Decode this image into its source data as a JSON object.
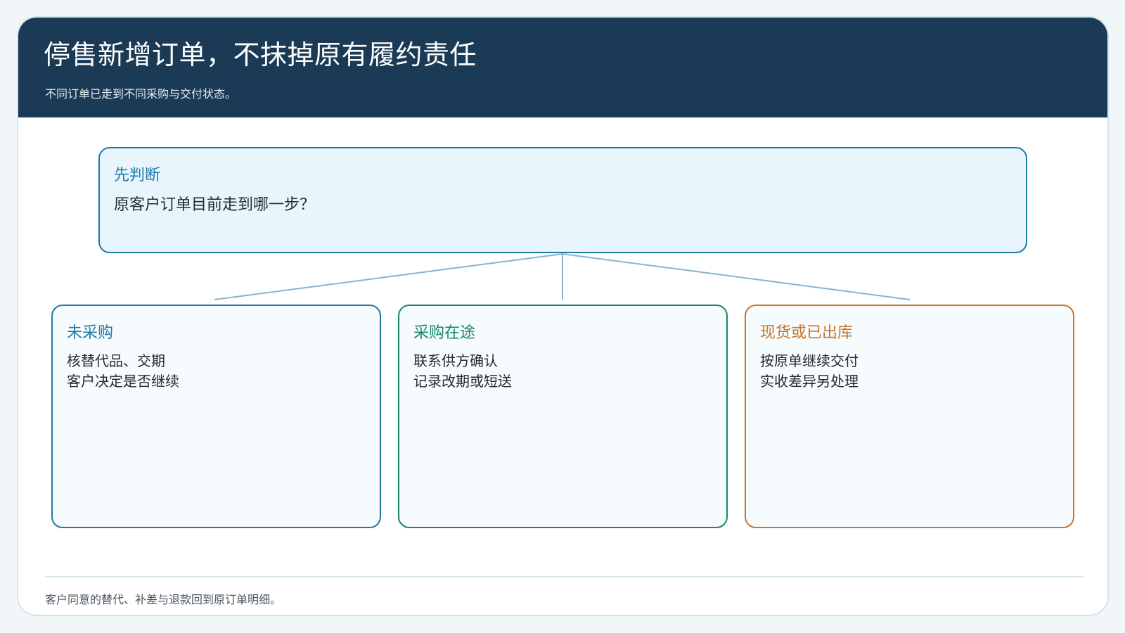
{
  "header": {
    "title": "停售新增订单，不抹掉原有履约责任",
    "subtitle": "不同订单已走到不同采购与交付状态。"
  },
  "root": {
    "label": "先判断",
    "question": "原客户订单目前走到哪一步？"
  },
  "branches": [
    {
      "title": "未采购",
      "lines": [
        "核替代品、交期",
        "客户决定是否继续"
      ],
      "color": "#1e7aa8"
    },
    {
      "title": "采购在途",
      "lines": [
        "联系供方确认",
        "记录改期或短送"
      ],
      "color": "#17876a"
    },
    {
      "title": "现货或已出库",
      "lines": [
        "按原单继续交付",
        "实收差异另处理"
      ],
      "color": "#c7762b"
    }
  ],
  "footer": {
    "note": "客户同意的替代、补差与退款回到原订单明细。"
  },
  "colors": {
    "header_bg": "#1b3a55",
    "root_accent": "#1e7aa8",
    "connector": "#86b4cc"
  }
}
